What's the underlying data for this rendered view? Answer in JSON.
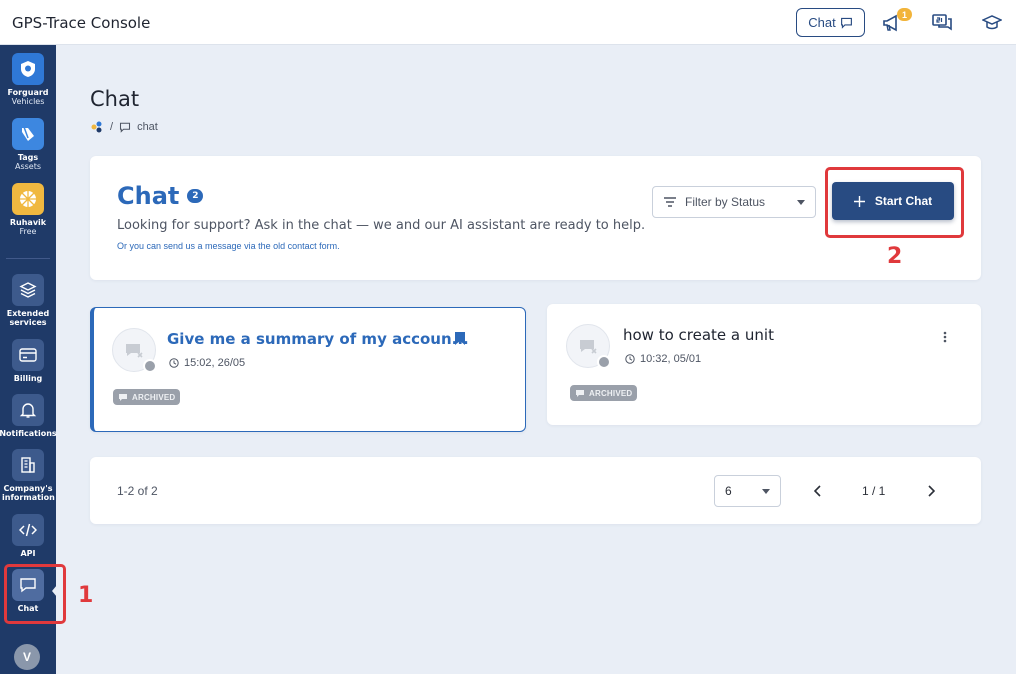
{
  "topbar": {
    "title": "GPS-Trace Console",
    "chat_button": "Chat",
    "notification_count": "1"
  },
  "sidebar": {
    "apps": [
      {
        "label": "Forguard",
        "sub": "Vehicles"
      },
      {
        "label": "Tags",
        "sub": "Assets"
      },
      {
        "label": "Ruhavik",
        "sub": "Free"
      }
    ],
    "items": [
      {
        "label": "Extended services"
      },
      {
        "label": "Billing"
      },
      {
        "label": "Notifications"
      },
      {
        "label": "Company's information"
      },
      {
        "label": "API"
      },
      {
        "label": "Chat"
      }
    ],
    "avatar": "V"
  },
  "annotations": {
    "step1": "1",
    "step2": "2"
  },
  "page": {
    "title": "Chat",
    "breadcrumb_sep": "/",
    "breadcrumb_current": "chat"
  },
  "header_card": {
    "title": "Chat",
    "count": "2",
    "description": "Looking for support? Ask in the chat — we and our AI assistant are ready to help.",
    "link_text": "Or you can send us a message via the old contact form.",
    "filter_placeholder": "Filter by Status",
    "start_button": "Start Chat"
  },
  "chats": [
    {
      "title": "Give me a summary of my accoun...",
      "time": "15:02, 26/05",
      "status": "ARCHIVED"
    },
    {
      "title": "how to create a unit",
      "time": "10:32, 05/01",
      "status": "ARCHIVED"
    }
  ],
  "pager": {
    "range": "1-2 of 2",
    "per_page": "6",
    "page": "1 / 1"
  },
  "colors": {
    "primary": "#284b82",
    "accent": "#2c69b9",
    "sidebar": "#1f3a68",
    "annotation": "#e0393c"
  }
}
